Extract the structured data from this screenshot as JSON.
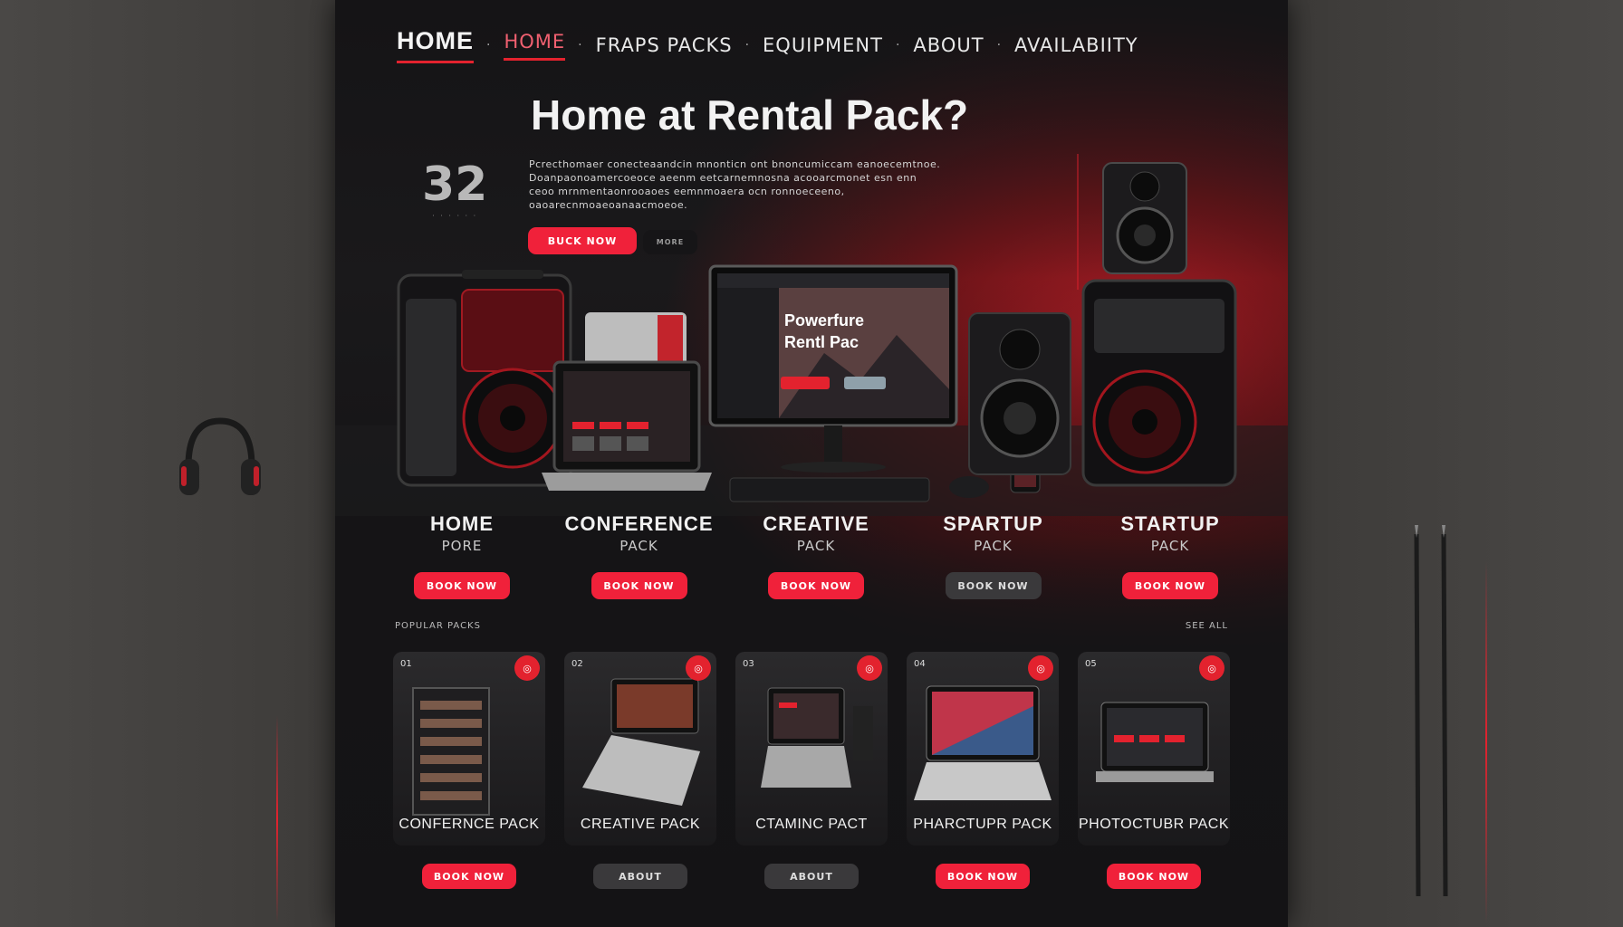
{
  "nav": {
    "brand": "HOME",
    "items": [
      "HOME",
      "FRAPS PACKS",
      "EQUIPMENT",
      "ABOUT",
      "AVAILABIITY"
    ]
  },
  "hero": {
    "title": "Home at Rental Pack?",
    "stat_number": "32",
    "body": "Pcrecthomaer conecteaandcin mnonticn ont bnoncumiccam eanoecemtnoe. Doanpaonoamercoeoce aeenm eetcarnemnosna acooarcmonet esn enn ceoo mrnmentaonrooaoes eemnmoaera ocn ronnoeceeno, oaoarecnmoaeoanaacmoeoe.",
    "primary_button": "BUCK NOW",
    "secondary_button": "MORE"
  },
  "screen": {
    "line1": "Powerfure",
    "line2": "Rentl Pac"
  },
  "packs": [
    {
      "title": "HOME",
      "subtitle": "PORE",
      "button": "BOOK NOW",
      "variant": "red"
    },
    {
      "title": "CONFERENCE",
      "subtitle": "PACK",
      "button": "BOOK NOW",
      "variant": "red"
    },
    {
      "title": "CREATIVE",
      "subtitle": "PACK",
      "button": "BOOK NOW",
      "variant": "red"
    },
    {
      "title": "SPARTUP",
      "subtitle": "PACK",
      "button": "BOOK NOW",
      "variant": "dark"
    },
    {
      "title": "STARTUP",
      "subtitle": "PACK",
      "button": "BOOK NOW",
      "variant": "red"
    }
  ],
  "section": {
    "left": "POPULAR PACKS",
    "right": "SEE ALL"
  },
  "cards": [
    {
      "name": "CONFERNCE PACK",
      "tag": "01",
      "button": "BOOK NOW",
      "variant": "red"
    },
    {
      "name": "CREATIVE PACK",
      "tag": "02",
      "button": "ABOUT",
      "variant": "dark"
    },
    {
      "name": "CTAMINC PACT",
      "tag": "03",
      "button": "ABOUT",
      "variant": "dark"
    },
    {
      "name": "PHARCTUPR PACK",
      "tag": "04",
      "button": "BOOK NOW",
      "variant": "red"
    },
    {
      "name": "PHOTOCTUBR PACK",
      "tag": "05",
      "button": "BOOK NOW",
      "variant": "red"
    }
  ],
  "colors": {
    "accent": "#e3222e",
    "background": "#1b1a1c",
    "wall": "#3e3c3a"
  }
}
